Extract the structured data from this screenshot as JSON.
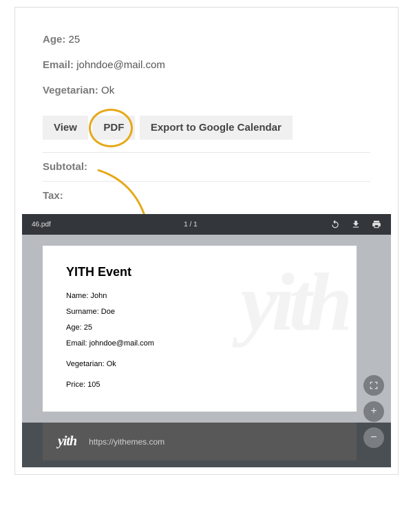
{
  "top": {
    "fields": {
      "age_label": "Age:",
      "age_value": "25",
      "email_label": "Email:",
      "email_value": "johndoe@mail.com",
      "veg_label": "Vegetarian:",
      "veg_value": "Ok"
    },
    "buttons": {
      "view": "View",
      "pdf": "PDF",
      "gcal": "Export to Google Calendar"
    },
    "totals": {
      "subtotal_label": "Subtotal:",
      "tax_label": "Tax:"
    }
  },
  "viewer": {
    "filename": "46.pdf",
    "page_indicator": "1 / 1"
  },
  "pdf": {
    "title": "YITH Event",
    "name_label": "Name:",
    "name_value": "John",
    "surname_label": "Surname:",
    "surname_value": "Doe",
    "age_label": "Age:",
    "age_value": "25",
    "email_label": "Email:",
    "email_value": "johndoe@mail.com",
    "veg_label": "Vegetarian:",
    "veg_value": "Ok",
    "price_label": "Price:",
    "price_value": "105",
    "watermark": "yith",
    "footer_logo": "yith",
    "footer_url": "https://yithemes.com"
  },
  "zoom": {
    "fit": "⊕",
    "plus": "+",
    "minus": "−"
  }
}
